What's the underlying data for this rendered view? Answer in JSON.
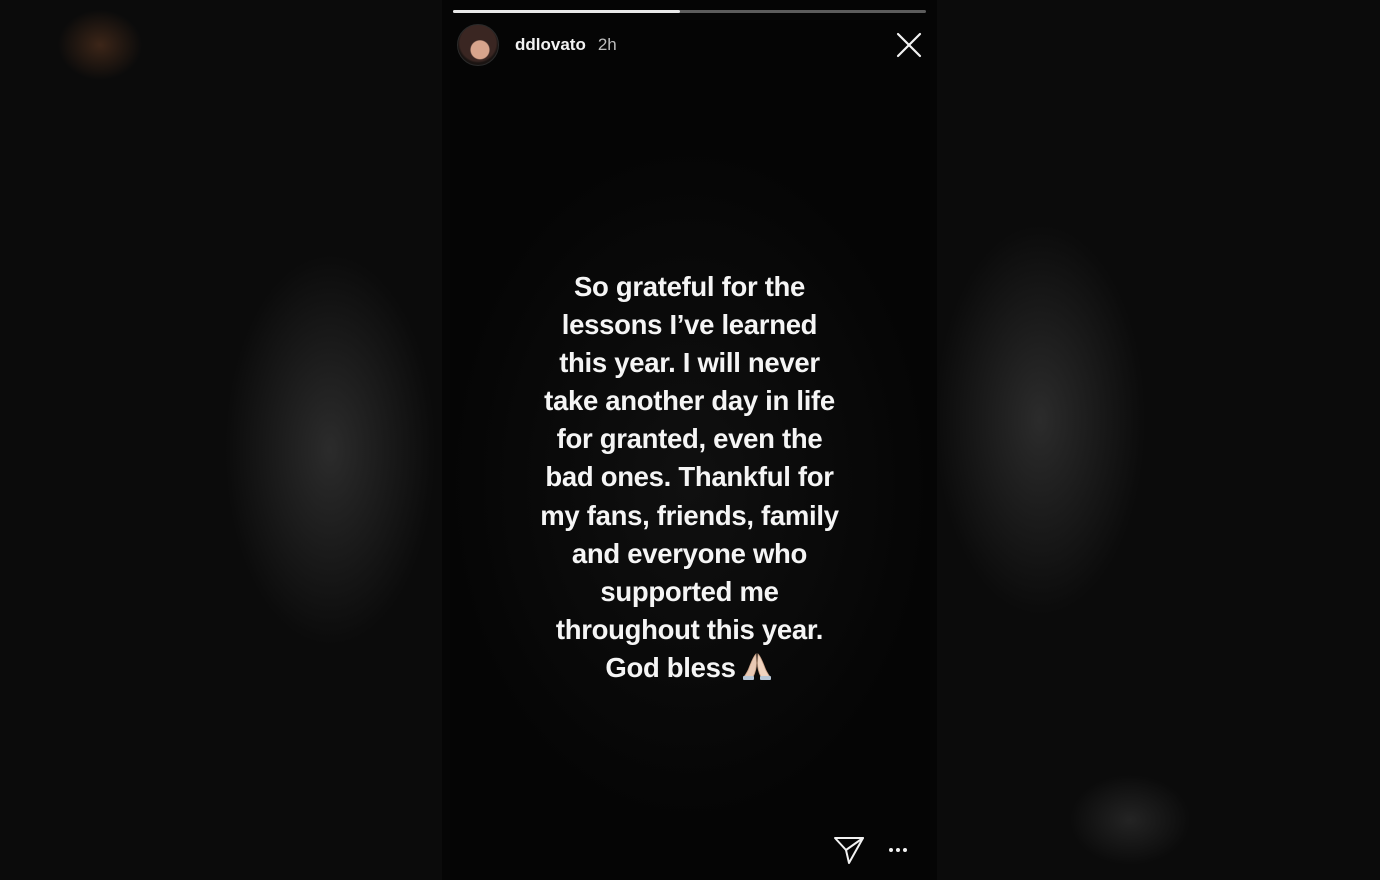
{
  "story": {
    "progress_fraction": 0.48,
    "user": {
      "username": "ddlovato",
      "time_ago": "2h"
    },
    "text": "So grateful for the\nlessons I’ve learned\nthis year. I will never\ntake another day in life\nfor granted, even the\nbad ones. Thankful for\nmy fans, friends, family\nand everyone who\nsupported me\nthroughout this year.\nGod bless",
    "emoji": "🙏"
  },
  "icons": {
    "close": "close-icon",
    "send": "send-icon",
    "more": "more-options-icon"
  },
  "colors": {
    "background": "#0a0a0a",
    "story_background": "#060606",
    "text": "#f5f5f5",
    "progress_track": "#5a5a5a",
    "progress_fill": "#e8e8e8"
  }
}
